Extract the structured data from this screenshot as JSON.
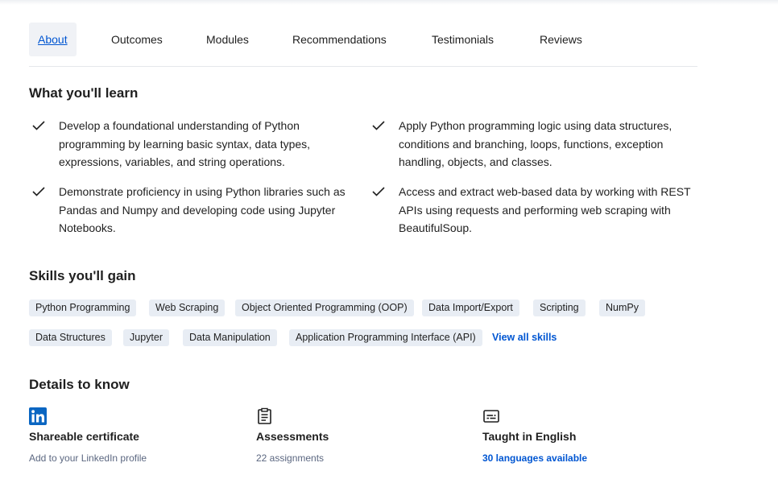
{
  "tabs": [
    {
      "label": "About",
      "active": true
    },
    {
      "label": "Outcomes"
    },
    {
      "label": "Modules"
    },
    {
      "label": "Recommendations"
    },
    {
      "label": "Testimonials"
    },
    {
      "label": "Reviews"
    }
  ],
  "learn": {
    "heading": "What you'll learn",
    "items": [
      "Develop a foundational understanding of Python programming by learning basic syntax, data types, expressions, variables, and string operations.",
      "Apply Python programming logic using data structures, conditions and branching, loops, functions, exception handling, objects, and classes.",
      "Demonstrate proficiency in using Python libraries such as Pandas and Numpy and developing code using Jupyter Notebooks.",
      "Access and extract web-based data by working with REST APIs using requests and performing web scraping with BeautifulSoup."
    ]
  },
  "skills": {
    "heading": "Skills you'll gain",
    "chips": [
      "Python Programming",
      "Web Scraping",
      "Object Oriented Programming (OOP)",
      "Data Import/Export",
      "Scripting",
      "NumPy",
      "Data Structures",
      "Jupyter",
      "Data Manipulation",
      "Application Programming Interface (API)"
    ],
    "view_all": "View all skills"
  },
  "details": {
    "heading": "Details to know",
    "items": [
      {
        "icon": "linkedin-icon",
        "title": "Shareable certificate",
        "subtitle": "Add to your LinkedIn profile"
      },
      {
        "icon": "clipboard-icon",
        "title": "Assessments",
        "subtitle": "22 assignments"
      },
      {
        "icon": "captions-icon",
        "title": "Taught in English",
        "subtitle": "30 languages available"
      }
    ]
  },
  "colors": {
    "accent": "#0056d2",
    "chip_bg": "#e8edf4",
    "linkedin": "#0a66c2"
  }
}
